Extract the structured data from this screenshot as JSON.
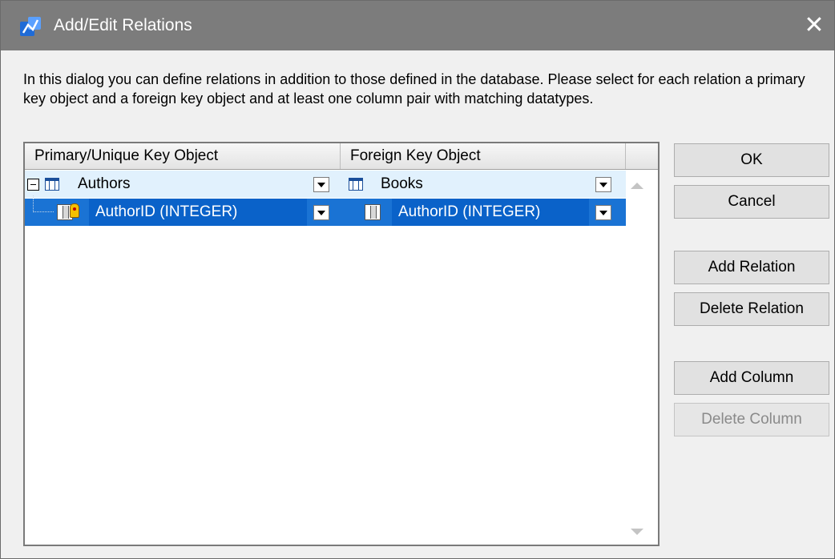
{
  "window": {
    "title": "Add/Edit Relations",
    "close_glyph": "✕"
  },
  "description": "In this dialog you can define relations in addition to those defined in the database.  Please select for each relation a primary key object and a foreign key object and at least one column pair with matching datatypes.",
  "grid": {
    "columns": [
      "Primary/Unique Key Object",
      "Foreign Key Object"
    ],
    "rows": [
      {
        "primary": "Authors",
        "foreign": "Books",
        "primary_icon": "table-icon",
        "foreign_icon": "table-icon",
        "expanded": true,
        "selected": false
      },
      {
        "primary": "AuthorID (INTEGER)",
        "foreign": "AuthorID (INTEGER)",
        "primary_icon": "primary-key-column-icon",
        "foreign_icon": "column-icon",
        "selected": true
      }
    ]
  },
  "buttons": {
    "ok": "OK",
    "cancel": "Cancel",
    "add_relation": "Add Relation",
    "delete_relation": "Delete Relation",
    "add_column": "Add Column",
    "delete_column": "Delete Column"
  },
  "colors": {
    "titlebar": "#7c7c7c",
    "selection": "#1a73d4",
    "row_highlight": "#e1f1fd"
  }
}
